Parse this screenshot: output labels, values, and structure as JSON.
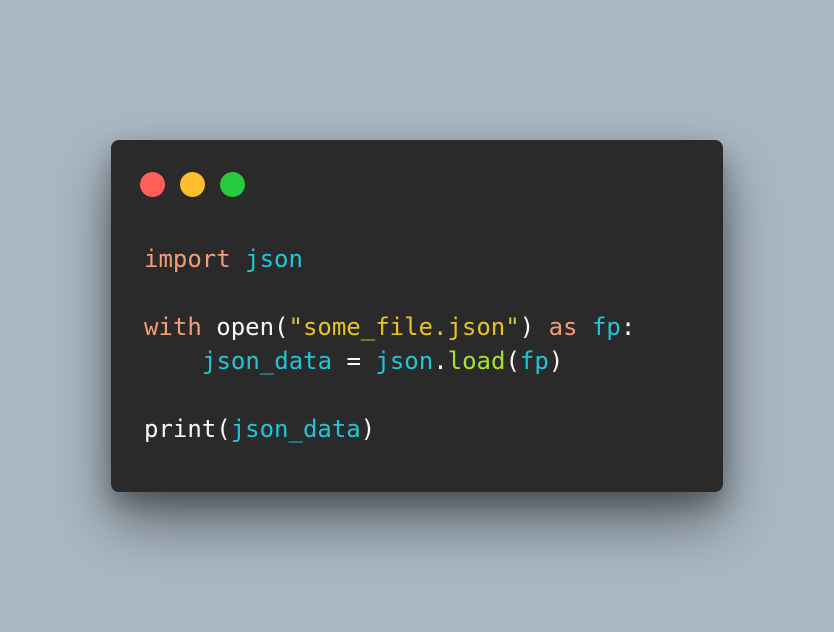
{
  "colors": {
    "background": "#abb8c3",
    "window": "#2a2a2a",
    "close": "#ff5f56",
    "minimize": "#ffbd2e",
    "maximize": "#27c93f",
    "keyword": "#f39c7a",
    "identifier": "#22c5d6",
    "string": "#e6c229",
    "function_call": "#a6e22e",
    "plain": "#f8f8f2"
  },
  "window_controls": {
    "close": "close-dot",
    "minimize": "minimize-dot",
    "maximize": "maximize-dot"
  },
  "code": {
    "line1": {
      "kw": "import",
      "sp": " ",
      "mod": "json"
    },
    "line3": {
      "kw": "with",
      "sp1": " ",
      "fn": "open",
      "p1": "(",
      "str": "\"some_file.json\"",
      "p2": ")",
      "sp2": " ",
      "kw2": "as",
      "sp3": " ",
      "var": "fp",
      "colon": ":"
    },
    "line4": {
      "var": "json_data",
      "eq": " = ",
      "mod": "json",
      "dot": ".",
      "fn": "load",
      "p1": "(",
      "arg": "fp",
      "p2": ")"
    },
    "line6": {
      "fn": "print",
      "p1": "(",
      "arg": "json_data",
      "p2": ")"
    }
  }
}
